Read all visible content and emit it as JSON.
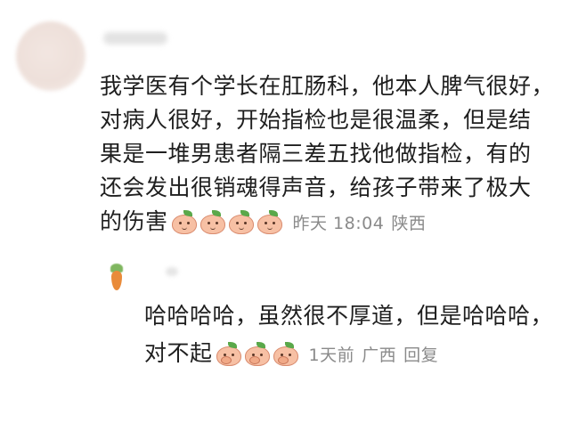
{
  "comment": {
    "lines": [
      "我学医有个学长在肛肠科，他本人脾气很好，",
      "对病人很好，开始指检也是很温柔，但是结",
      "果是一堆男患者隔三差五找他做指检，有的",
      "还会发出很销魂得声音，给孩子带来了极大",
      "的伤害"
    ],
    "emojis": [
      "peach-smile-icon",
      "peach-smile-icon",
      "peach-smile-icon",
      "peach-smile-icon"
    ],
    "time": "昨天 18:04",
    "location": "陕西"
  },
  "reply": {
    "lines": [
      "哈哈哈哈，虽然很不厚道，但是哈哈哈，",
      "对不起"
    ],
    "emojis": [
      "peach-cover-mouth-icon",
      "peach-cover-mouth-icon",
      "peach-cover-mouth-icon"
    ],
    "time": "1天前",
    "location": "广西",
    "reply_label": "回复"
  }
}
